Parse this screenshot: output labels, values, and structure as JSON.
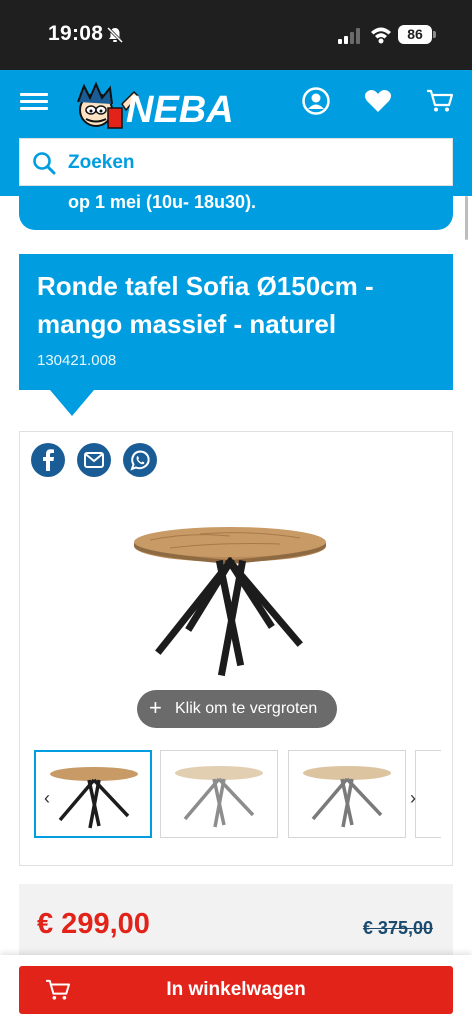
{
  "status_bar": {
    "time": "19:08",
    "battery": "86"
  },
  "header": {
    "logo_text": "NEBA"
  },
  "search": {
    "placeholder": "Zoeken"
  },
  "promo": {
    "text": "op 1 mei (10u- 18u30)."
  },
  "product": {
    "title": "Ronde tafel Sofia Ø150cm - mango massief - naturel",
    "sku": "130421.008"
  },
  "gallery": {
    "zoom_label": "Klik om te vergroten",
    "zoom_symbol": "+",
    "arrow_left": "‹",
    "arrow_right": "›"
  },
  "share_icons": [
    "facebook-icon",
    "mail-icon",
    "whatsapp-icon"
  ],
  "pricing": {
    "price": "€ 299,00",
    "old_price": "€ 375,00"
  },
  "cta": {
    "add_to_cart": "In winkelwagen"
  },
  "colors": {
    "brand_blue": "#009ee0",
    "accent_red": "#e2231a",
    "share_blue": "#1a5d96",
    "status_bar": "#1f1f1f"
  }
}
